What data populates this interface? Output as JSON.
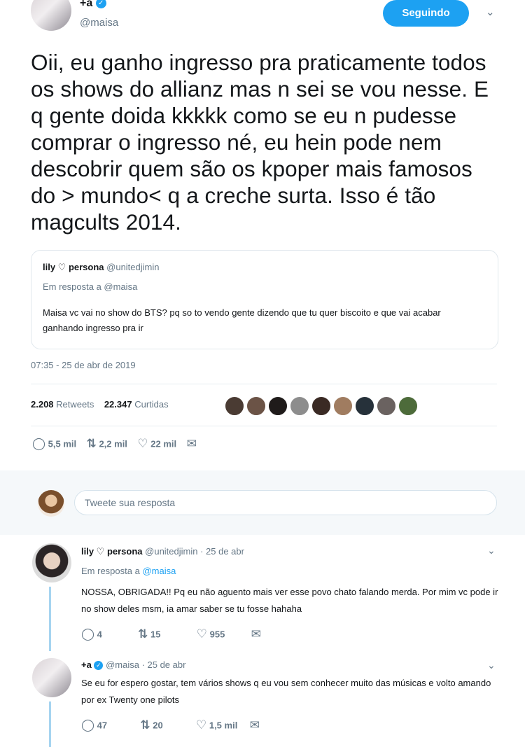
{
  "tweet": {
    "display_name": "+a",
    "handle": "@maisa",
    "follow_label": "Seguindo",
    "text": "Oii, eu ganho ingresso pra praticamente todos os shows do allianz mas n sei se vou nesse. E q gente doida kkkkk como se eu n pudesse comprar o ingresso né, eu hein pode nem descobrir quem são os kpoper mais famosos do > mundo< q a creche surta. Isso é tão magcults 2014.",
    "timestamp": "07:35 - 25 de abr de 2019",
    "retweets_count": "2.208",
    "retweets_label": "Retweets",
    "likes_count": "22.347",
    "likes_label": "Curtidas",
    "actions": {
      "replies": "5,5 mil",
      "retweets": "2,2 mil",
      "likes": "22 mil"
    }
  },
  "quoted": {
    "display_name": "lily ♡ persona",
    "handle": "@unitedjimin",
    "reply_to": "Em resposta a @maisa",
    "text": "Maisa vc vai no show do BTS? pq so to vendo gente dizendo que tu quer biscoito e que vai acabar ganhando ingresso pra ir"
  },
  "reply_box": {
    "placeholder": "Tweete sua resposta"
  },
  "replies": [
    {
      "display_name": "lily ♡ persona",
      "meta": "@unitedjimin · 25 de abr",
      "reply_prefix": "Em resposta a ",
      "reply_handle": "@maisa",
      "text": "NOSSA, OBRIGADA!! Pq eu não aguento mais ver esse povo chato falando merda. Por mim vc pode ir no show deles msm, ia amar saber se tu fosse hahaha",
      "replies": "4",
      "retweets": "15",
      "likes": "955"
    },
    {
      "display_name": "+a",
      "meta": "@maisa · 25 de abr",
      "text": "Se eu for espero gostar, tem vários shows q eu vou sem conhecer muito das músicas e volto amando por ex Twenty one pilots",
      "replies": "47",
      "retweets": "20",
      "likes": "1,5 mil"
    }
  ],
  "icons": {
    "reply": "reply-icon",
    "retweet": "retweet-icon",
    "like": "heart-icon",
    "dm": "envelope-icon",
    "chevron": "chevron-down-icon",
    "verified": "verified-badge-icon"
  },
  "colors": {
    "accent": "#1da1f2",
    "muted": "#657786",
    "thread": "#a6d4f0"
  }
}
